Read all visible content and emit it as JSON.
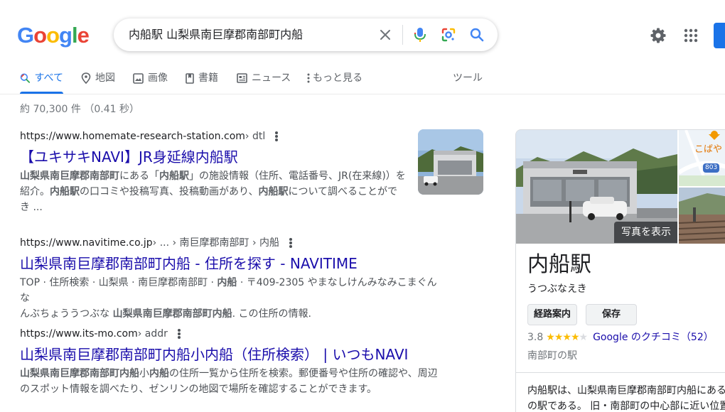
{
  "header": {
    "logo_letters": [
      {
        "ch": "G",
        "color": "#4285f4"
      },
      {
        "ch": "o",
        "color": "#ea4335"
      },
      {
        "ch": "o",
        "color": "#fbbc05"
      },
      {
        "ch": "g",
        "color": "#4285f4"
      },
      {
        "ch": "l",
        "color": "#34a853"
      },
      {
        "ch": "e",
        "color": "#ea4335"
      }
    ],
    "query": "内船駅 山梨県南巨摩郡南部町内船",
    "icons": [
      "close-icon",
      "microphone-icon",
      "lens-camera-icon",
      "search-icon",
      "gear-icon",
      "apps-grid-icon"
    ]
  },
  "tabs": {
    "items": [
      {
        "label": "すべて",
        "icon": "search-icon"
      },
      {
        "label": "地図",
        "icon": "map-pin-icon"
      },
      {
        "label": "画像",
        "icon": "image-icon"
      },
      {
        "label": "書籍",
        "icon": "book-icon"
      },
      {
        "label": "ニュース",
        "icon": "news-icon"
      },
      {
        "label": "もっと見る",
        "icon": "more-vert-icon"
      }
    ],
    "tools": "ツール"
  },
  "stats": "約 70,300 件 （0.41 秒）",
  "results": [
    {
      "site": "https://www.homemate-research-station.com",
      "path": " › dtl",
      "title": "【ユキサキNAVI】JR身延線内船駅",
      "snippet_html": "<b>山梨県南巨摩郡南部町</b>にある「<b>内船駅</b>」の施設情報（住所、電話番号、JR(在来線)）を<br>紹介。<b>内船駅</b>の口コミや投稿写真、投稿動画があり、<b>内船駅</b>について調べることがで<br>き ..."
    },
    {
      "site": "https://www.navitime.co.jp",
      "path": " › ... › 南巨摩郡南部町 › 内船",
      "title": "山梨県南巨摩郡南部町内船 - 住所を探す - NAVITIME",
      "snippet_html": "TOP · 住所検索 · 山梨県 · 南巨摩郡南部町 · <b>内船</b> · 〒409-2305 やまなしけんみなみこまぐんな<br>んぶちょううつぶな <b>山梨県南巨摩郡南部町内船</b>. この住所の情報."
    },
    {
      "site": "https://www.its-mo.com",
      "path": " › addr",
      "title": "山梨県南巨摩郡南部町内船小内船（住所検索） | いつもNAVI",
      "snippet_html": "<b>山梨県南巨摩郡南部町内船</b>小<b>内船</b>の住所一覧から住所を検索。郵便番号や住所の確認や、周辺<br>のスポット情報を調べたり、ゼンリンの地図で場所を確認することができます。"
    }
  ],
  "knowledge_panel": {
    "photo_button": "写真を表示",
    "map_label": "こばや",
    "map_route": "803",
    "title": "内船駅",
    "reading": "うつぶなえき",
    "directions_button": "経路案内",
    "save_button": "保存",
    "rating": "3.8",
    "stars_filled": 4,
    "reviews_label": "Google のクチコミ",
    "reviews_count": "（52）",
    "type": "南部町の駅",
    "description_line1": "内船駅は、山梨県南巨摩郡南部町内船にある",
    "description_line2": "の駅である。 旧・南部町の中心部に近い位置"
  }
}
